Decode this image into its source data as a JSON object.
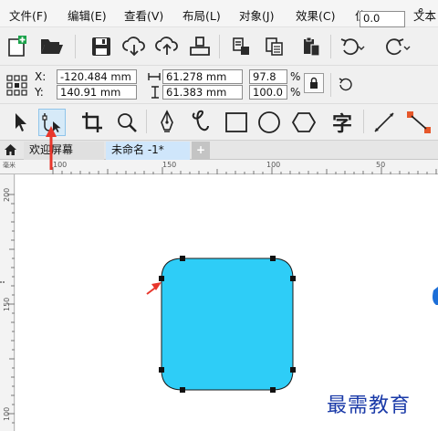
{
  "menu": [
    "文件(F)",
    "编辑(E)",
    "查看(V)",
    "布局(L)",
    "对象(J)",
    "效果(C)",
    "位图(B)",
    "文本"
  ],
  "icons_toolbar1": [
    "new-document-icon",
    "open-folder-icon",
    "save-icon",
    "import-cloud-icon",
    "export-cloud-icon",
    "publish-pdf-icon",
    "copy-properties-icon",
    "paste-icon",
    "clipboard-icon",
    "undo-icon",
    "redo-icon"
  ],
  "props": {
    "x_label": "X:",
    "x_value": "-120.484 mm",
    "y_label": "Y:",
    "y_value": "140.91 mm",
    "w_value": "61.278 mm",
    "h_value": "61.383 mm",
    "scale_x": "97.8",
    "scale_y": "100.0",
    "percent": "%",
    "rotation": "0.0",
    "degree": "°"
  },
  "tools": [
    "pick-tool-icon",
    "shape-tool-icon",
    "crop-tool-icon",
    "zoom-tool-icon",
    "pen-tool-icon",
    "freehand-tool-icon",
    "rectangle-tool-icon",
    "ellipse-tool-icon",
    "polygon-tool-icon",
    "text-tool-icon",
    "dimension-tool-icon",
    "connector-tool-icon"
  ],
  "text_tool_glyph": "字",
  "tabs": {
    "welcome": "欢迎屏幕",
    "document": "未命名 -1*",
    "add": "+"
  },
  "ruler": {
    "h_marks": [
      "100",
      "150",
      "100",
      "50"
    ],
    "v_marks": [
      "200",
      "150",
      "100"
    ],
    "unit": "毫米"
  },
  "shape": {
    "fill": "#2ecdf7",
    "stroke": "#1a1a1a"
  },
  "accent": "#e8372c",
  "watermark": "最需教育"
}
